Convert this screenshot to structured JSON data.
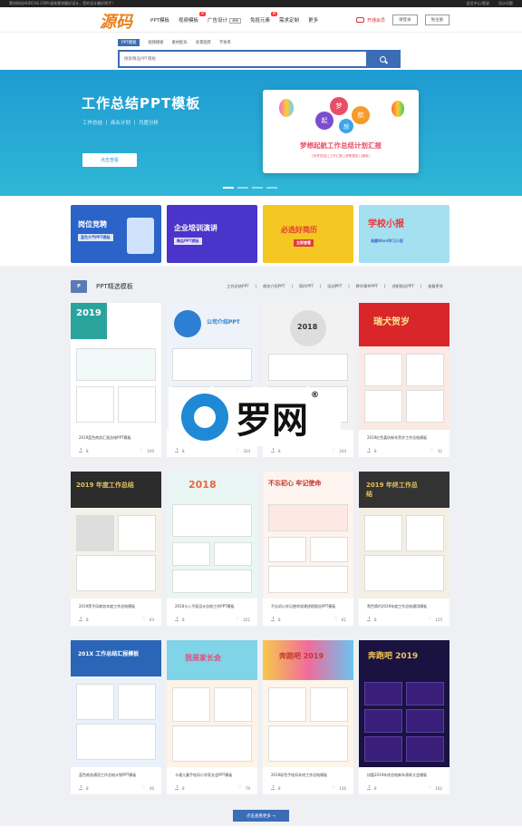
{
  "topbar": {
    "left": "素材网站HUDCAE.COM-极致素材最好设计，您的设计最好帮手！",
    "right": [
      "会员中心/登录",
      "设计问题"
    ]
  },
  "nav": {
    "logo": "源码",
    "items": [
      {
        "label": "PPT模板",
        "badge": ""
      },
      {
        "label": "视频模板",
        "badge": "热"
      },
      {
        "label": "广告设计",
        "badge": "",
        "tag": "限免"
      },
      {
        "label": "免抠元素",
        "badge": "新"
      },
      {
        "label": "需求定制",
        "badge": ""
      },
      {
        "label": "更多",
        "badge": ""
      }
    ],
    "vip_label": "开通会员",
    "login_label": "请登录",
    "register_label": "免注册"
  },
  "search": {
    "tabs": [
      "PPT模板",
      "视频模板",
      "素材配乐",
      "背景图库",
      "字体库"
    ],
    "placeholder": "搜索精品PPT模板"
  },
  "banner": {
    "title": "工作总结PPT模板",
    "subtitle": "工作总结 丨 商业计划 丨 月度分析",
    "cta": "点击查看",
    "card_balloons": [
      "起",
      "梦",
      "想",
      "航"
    ],
    "card_title": "梦想起航工作总结计划汇报",
    "card_sub": "[年终总结] [工作汇报] [述职报告] [通用]",
    "slides": 4,
    "active_slide": 1
  },
  "promos": [
    {
      "title": "岗位竞聘",
      "sub": "蓝色大气PPT模板"
    },
    {
      "title": "企业培训演讲",
      "sub": "精品PPT模板"
    },
    {
      "title": "必选好简历",
      "sub": "立即查看"
    },
    {
      "title": "学校小报",
      "sub": "海量Word学习小报"
    }
  ],
  "section": {
    "icon": "P",
    "title": "PPT精选模板",
    "links": [
      "工作总结PPT",
      "商务介绍PPT",
      "简约PPT",
      "培训PPT",
      "教学课件PPT",
      "述职报告PPT",
      "查看更多"
    ]
  },
  "cards": [
    {
      "thumb_text": "2019",
      "caption": "2019蓝色商务汇报总结PPT模板",
      "downloads": "8",
      "likes": "100"
    },
    {
      "thumb_text": "公司介绍PPT",
      "caption": "",
      "downloads": "8",
      "likes": "334"
    },
    {
      "thumb_text": "2018",
      "caption": "",
      "downloads": "8",
      "likes": "244"
    },
    {
      "thumb_text": "瑞犬贺岁",
      "caption": "2019红色喜庆新年贺岁工作总结模板",
      "downloads": "8",
      "likes": "32"
    },
    {
      "thumb_text": "2019 年度工作总结",
      "caption": "2019黑平风商务年度工作总结模板",
      "downloads": "8",
      "likes": "63"
    },
    {
      "thumb_text": "2018",
      "caption": "2018卡入平面设计总结工作PPT模板",
      "downloads": "8",
      "likes": "221"
    },
    {
      "thumb_text": "不忘初心 牢记使命",
      "caption": "不忘初心牢记使命党建述职报告PPT模板",
      "downloads": "8",
      "likes": "61"
    },
    {
      "thumb_text": "2019 年终工作总结",
      "caption": "黑色简约2019年度工作总结通用模板",
      "downloads": "8",
      "likes": "155"
    },
    {
      "thumb_text": "201X 工作总结汇报模板",
      "caption": "蓝色商务通用工作总结计划PPT模板",
      "downloads": "8",
      "likes": "40"
    },
    {
      "thumb_text": "我是家长会",
      "caption": "卡通儿童手绘风小学家长会PPT模板",
      "downloads": "8",
      "likes": "79"
    },
    {
      "thumb_text": "奔跑吧 2019",
      "caption": "2019彩色手绘风年终工作总结模板",
      "downloads": "8",
      "likes": "136"
    },
    {
      "thumb_text": "奔跑吧 2019",
      "caption": "炫酷2019年终总结新年表彰大会模板",
      "downloads": "8",
      "likes": "162"
    }
  ],
  "more_label": "点击查看更多 →",
  "watermark": {
    "text": "罗网",
    "reg": "®"
  }
}
